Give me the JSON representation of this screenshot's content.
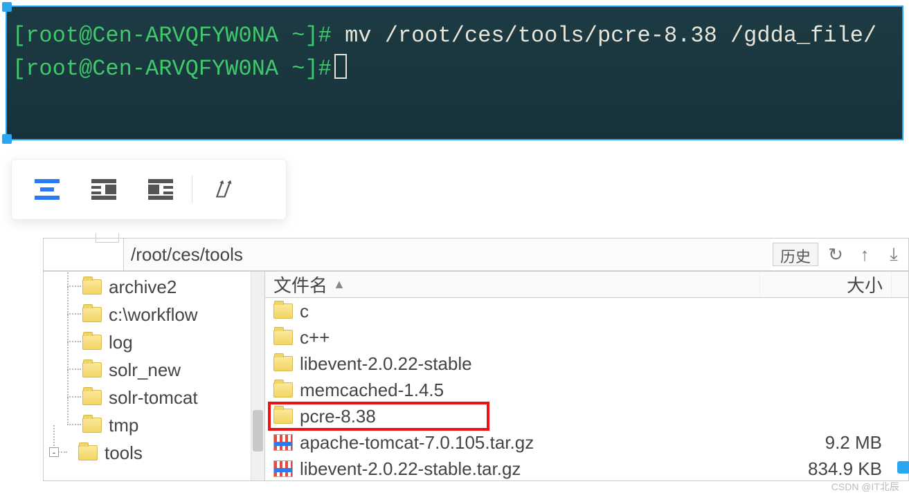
{
  "terminal": {
    "lines": [
      {
        "prompt": "[root@Cen-ARVQFYW0NA ~]#",
        "cmd": " mv /root/ces/tools/pcre-8.38  /gdda_file/"
      },
      {
        "prompt": "[root@Cen-ARVQFYW0NA ~]#",
        "cmd": ""
      }
    ]
  },
  "toolbar": {
    "align_left_icon": "align-left-icon",
    "align_right_block_icon": "align-right-block-icon",
    "align_left_block_icon": "align-left-block-icon",
    "crop_icon": "crop-icon"
  },
  "browser": {
    "path": "/root/ces/tools",
    "history_label": "历史",
    "refresh_icon": "refresh-icon",
    "up_icon": "up-arrow-icon",
    "download_icon": "download-icon",
    "headers": {
      "name": "文件名",
      "size": "大小"
    },
    "tree": [
      {
        "label": "archive2"
      },
      {
        "label": "c:\\workflow"
      },
      {
        "label": "log"
      },
      {
        "label": "solr_new"
      },
      {
        "label": "solr-tomcat"
      },
      {
        "label": "tmp"
      },
      {
        "label": "tools",
        "expandable": true
      }
    ],
    "files": [
      {
        "name": "c",
        "type": "folder",
        "size": ""
      },
      {
        "name": "c++",
        "type": "folder",
        "size": ""
      },
      {
        "name": "libevent-2.0.22-stable",
        "type": "folder",
        "size": ""
      },
      {
        "name": "memcached-1.4.5",
        "type": "folder",
        "size": ""
      },
      {
        "name": "pcre-8.38",
        "type": "folder",
        "size": "",
        "highlighted": true
      },
      {
        "name": "apache-tomcat-7.0.105.tar.gz",
        "type": "archive",
        "size": "9.2 MB"
      },
      {
        "name": "libevent-2.0.22-stable.tar.gz",
        "type": "archive",
        "size": "834.9 KB"
      }
    ]
  },
  "watermark": "CSDN @IT北辰"
}
